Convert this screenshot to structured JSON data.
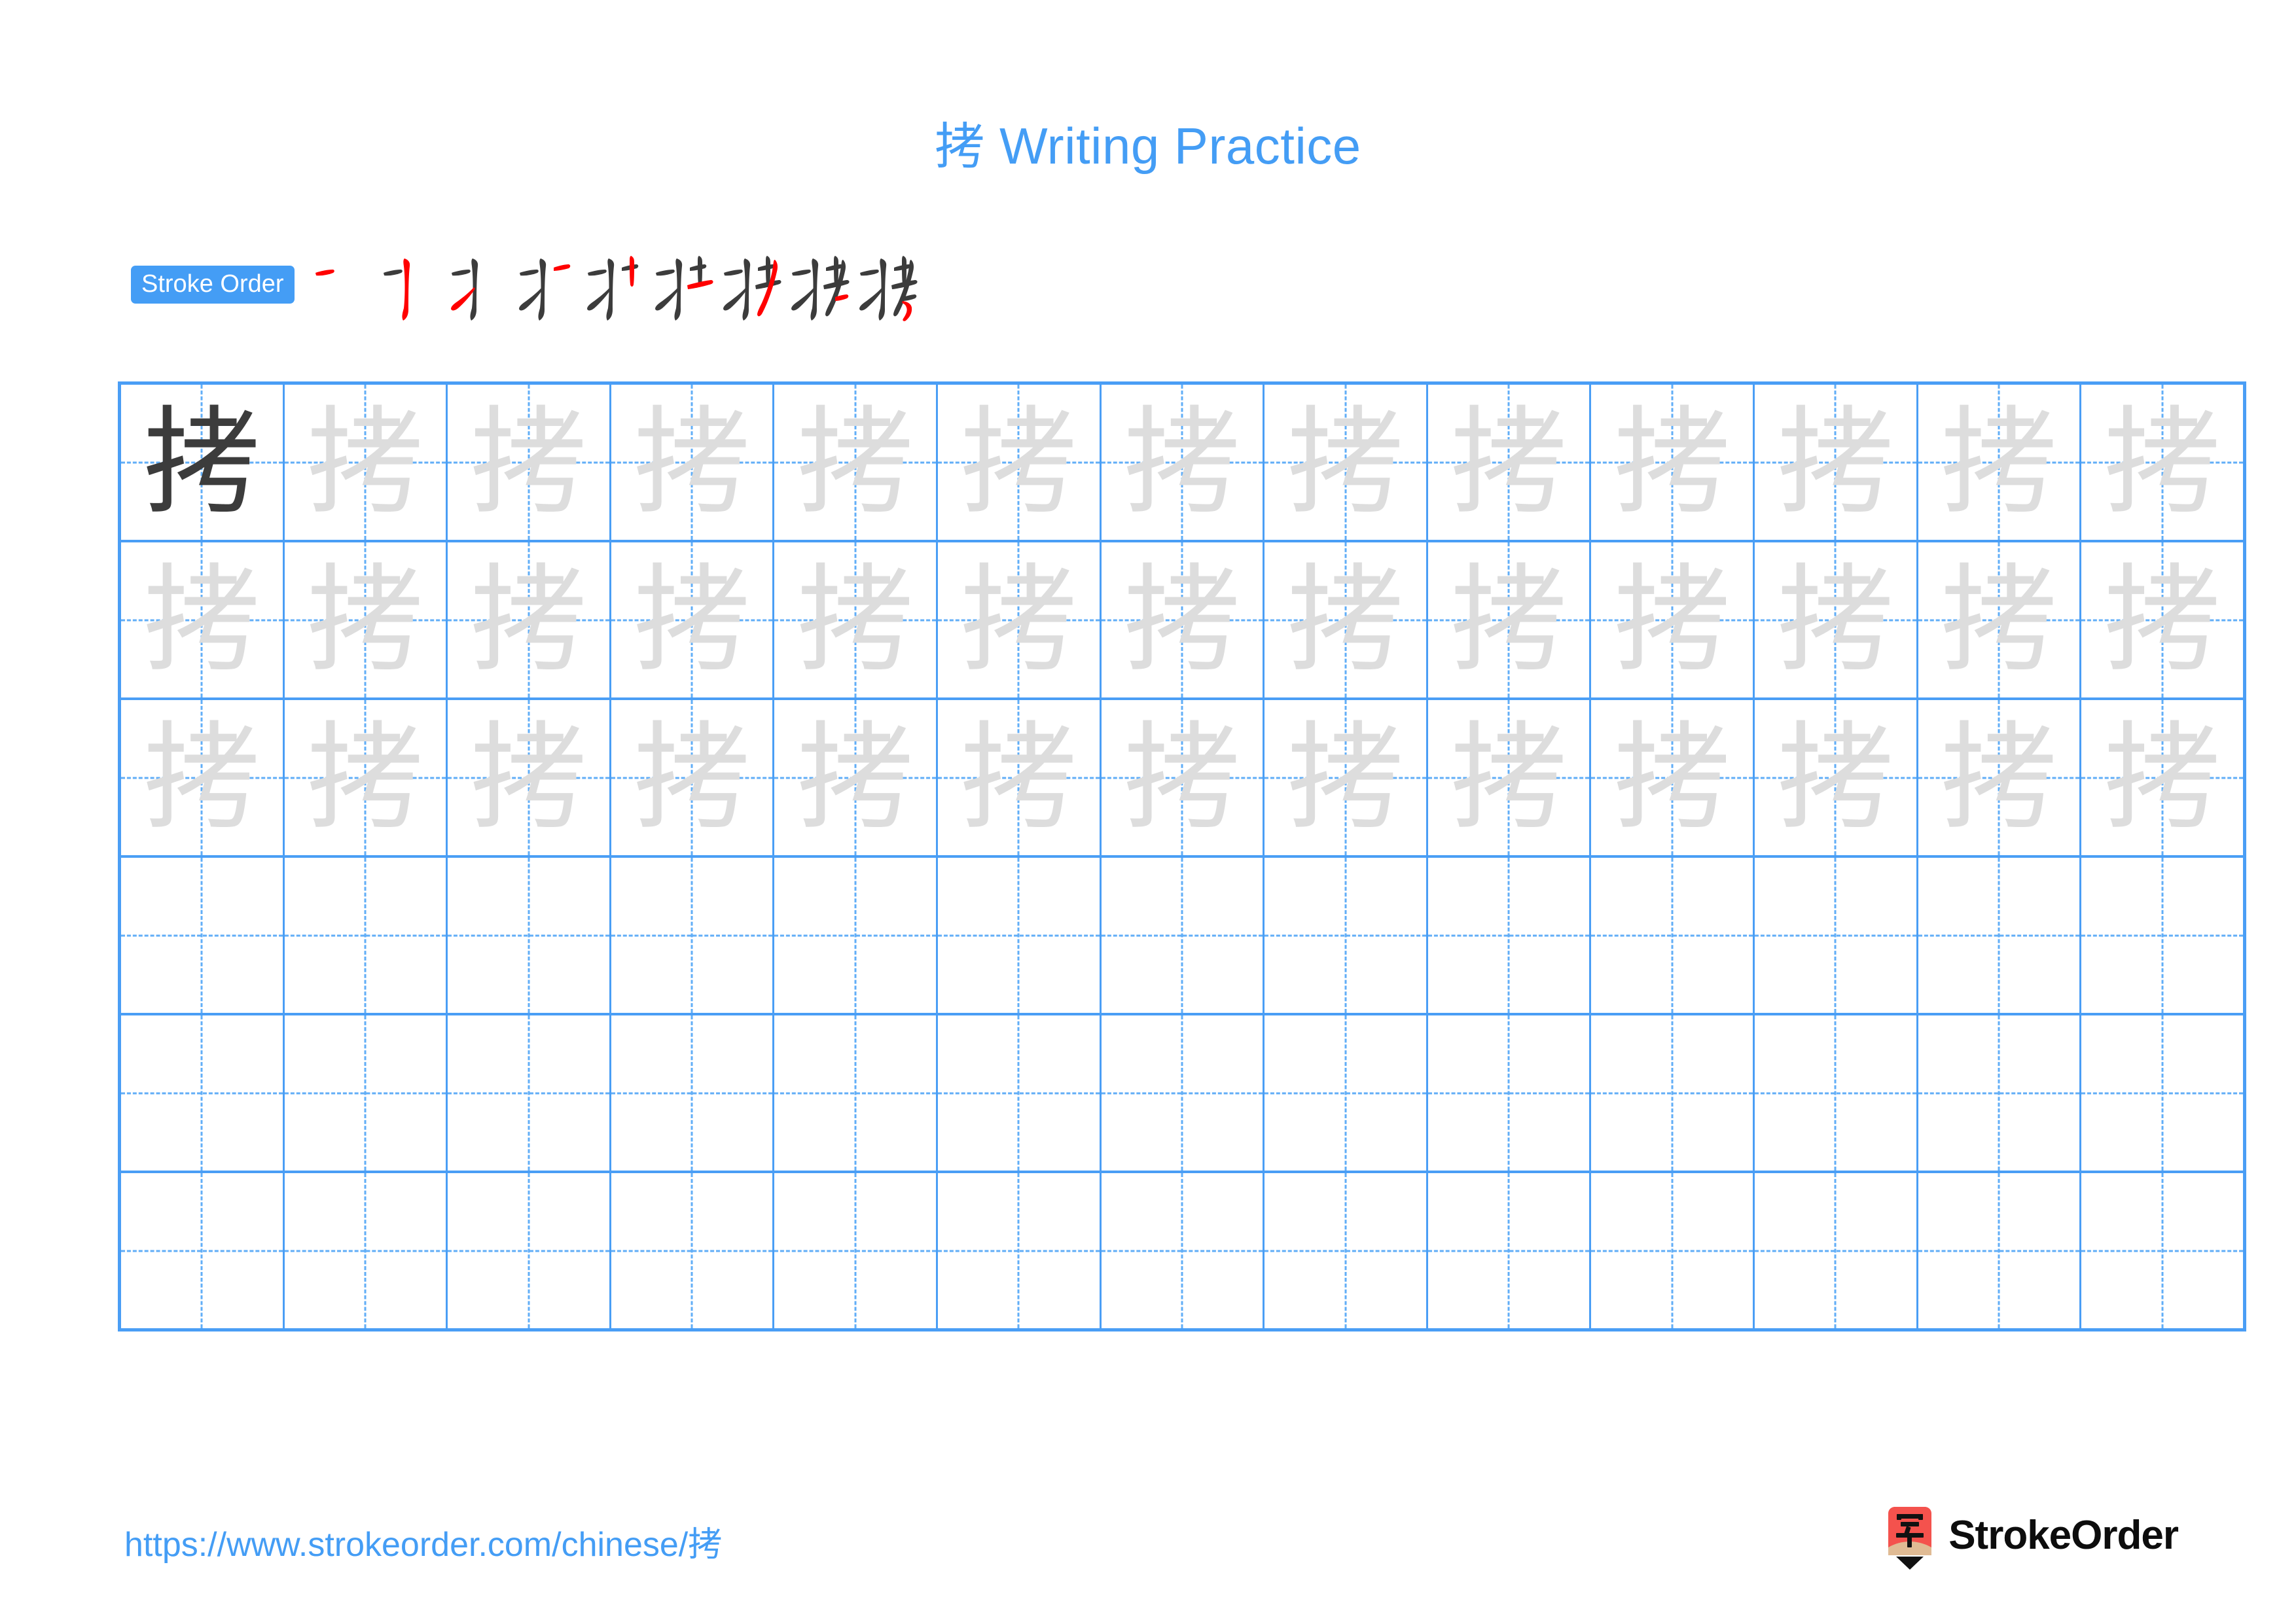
{
  "page": {
    "character": "拷",
    "title_prefix": "拷",
    "title_suffix": " Writing Practice",
    "title_full": "拷 Writing Practice",
    "accent_blue": "#449df5",
    "grid_blue": "#4a9ef5",
    "guide_blue": "#61aef7",
    "stroke_new_color": "#ff0000",
    "stroke_done_color": "#3c3c3c",
    "model_char_color": "#3c3c3c",
    "trace_char_color": "#dddddd"
  },
  "stroke_order": {
    "badge_label": "Stroke Order",
    "stroke_count": 9,
    "steps": [
      {
        "index": 1,
        "cumulative": "一"
      },
      {
        "index": 2,
        "cumulative": "丁"
      },
      {
        "index": 3,
        "cumulative": "扌"
      },
      {
        "index": 4,
        "cumulative": "扩"
      },
      {
        "index": 5,
        "cumulative": "扩"
      },
      {
        "index": 6,
        "cumulative": "扗"
      },
      {
        "index": 7,
        "cumulative": "扷"
      },
      {
        "index": 8,
        "cumulative": "挊"
      },
      {
        "index": 9,
        "cumulative": "拷"
      }
    ]
  },
  "grid": {
    "columns": 13,
    "rows": 6,
    "traced_rows": 3,
    "blank_rows": 3,
    "model_cell": {
      "row": 1,
      "column": 1,
      "char": "拷"
    },
    "trace_char": "拷"
  },
  "footer": {
    "url": "https://www.strokeorder.com/chinese/拷",
    "brand_name": "StrokeOrder",
    "logo_char": "字",
    "logo_body_color": "#f4524d",
    "logo_tip_color": "#e0bb94",
    "logo_point_color": "#111111"
  }
}
